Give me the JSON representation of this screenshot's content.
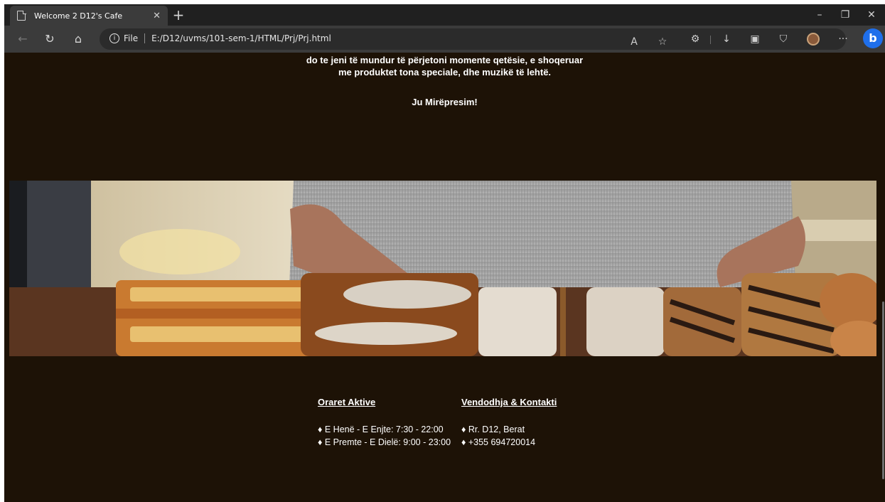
{
  "browser": {
    "tab_title": "Welcome 2 D12's Cafe",
    "tab_close": "✕",
    "new_tab": "+",
    "window_controls": {
      "minimize": "–",
      "restore": "❐",
      "close": "✕"
    },
    "nav": {
      "back": "←",
      "refresh": "↻",
      "home": "⌂"
    },
    "url_scheme_label": "File",
    "url": "E:/D12/uvms/101-sem-1/HTML/Prj/Prj.html",
    "tools": {
      "read_aloud": "A",
      "favorite": "☆",
      "extensions": "⚙",
      "downloads": "↓",
      "collections": "▣",
      "shield": "⛉",
      "more": "···",
      "bing": "b"
    },
    "icons": [
      "page-icon",
      "back-icon",
      "refresh-icon",
      "home-icon",
      "info-icon",
      "read-aloud-icon",
      "favorite-icon",
      "extensions-icon",
      "downloads-icon",
      "collections-icon",
      "browser-essentials-icon",
      "profile-avatar",
      "more-icon",
      "bing-icon"
    ]
  },
  "page": {
    "intro_line1": "do te jeni të mundur të përjetoni momente qetësie, e shoqeruar",
    "intro_line2": "me produktet tona speciale, dhe muzikë të lehtë.",
    "welcome": "Ju Mirëpresim!",
    "hours": {
      "heading": "Oraret Aktive",
      "items": [
        "♦ E Henë - E Enjte: 7:30 - 22:00",
        "♦ E Premte - E Dielë: 9:00 - 23:00"
      ]
    },
    "location": {
      "heading": "Vendodhja & Kontakti",
      "items": [
        "♦ Rr. D12, Berat",
        "♦ +355 694720014"
      ]
    },
    "colors": {
      "background": "#1d1206",
      "text": "#ffffff"
    }
  }
}
